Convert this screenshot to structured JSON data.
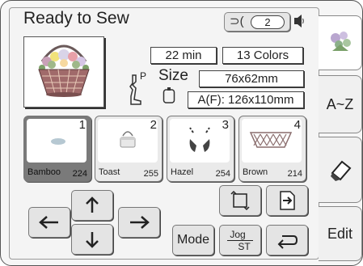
{
  "title": "Ready to Sew",
  "stitch_counter": {
    "value": "2"
  },
  "info": {
    "time": "22 min",
    "colors": "13 Colors",
    "presser_foot_label": "P",
    "size_label": "Size",
    "size_value": "76x62mm",
    "hoop_value": "A(F): 126x110mm"
  },
  "thread_slots": [
    {
      "number": "1",
      "name": "Bamboo",
      "code": "224",
      "selected": true,
      "color": "#b6c8d2"
    },
    {
      "number": "2",
      "name": "Toast",
      "code": "255",
      "selected": false,
      "color": "#e6e6e6"
    },
    {
      "number": "3",
      "name": "Hazel",
      "code": "254",
      "selected": false,
      "color": "#555555"
    },
    {
      "number": "4",
      "name": "Brown",
      "code": "214",
      "selected": false,
      "color": "#8a6d6d"
    }
  ],
  "buttons": {
    "mode": "Mode",
    "jog_top": "Jog",
    "jog_bottom": "ST"
  },
  "side_tabs": {
    "az": "A~Z",
    "edit": "Edit"
  },
  "icons": {
    "up": "arrow-up-icon",
    "down": "arrow-down-icon",
    "left": "arrow-left-icon",
    "right": "arrow-right-icon",
    "rotate": "rotate-icon",
    "page_next": "page-next-icon",
    "return": "return-icon",
    "eraser": "eraser-icon",
    "flower": "flower-icon",
    "speaker": "speaker-icon",
    "foot": "presser-foot-icon",
    "hoop": "hoop-icon"
  }
}
